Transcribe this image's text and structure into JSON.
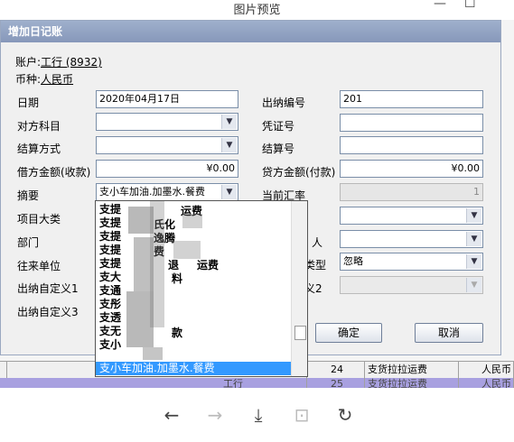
{
  "viewer": {
    "title": "图片预览",
    "minimize": "—",
    "maximize": "☐",
    "toolbar": {
      "prev": "←",
      "next": "→",
      "download": "⤓",
      "fit": "⊡",
      "rotate": "↻"
    }
  },
  "dialog": {
    "title": "增加日记账",
    "account_label": "账户:",
    "account_value": "工行 (8932)",
    "currency_label": "币种:",
    "currency_value": "人民币",
    "fields": {
      "date_label": "日期",
      "date_value": "2020年04月17日",
      "cashier_no_label": "出纳编号",
      "cashier_no_value": "201",
      "counter_subject_label": "对方科目",
      "voucher_no_label": "凭证号",
      "settle_method_label": "结算方式",
      "settle_no_label": "结算号",
      "debit_label": "借方金额(收款)",
      "debit_value": "¥0.00",
      "credit_label": "贷方金额(付款)",
      "credit_value": "¥0.00",
      "summary_label": "摘要",
      "summary_value": "支小车加油.加墨水.餐费",
      "exchange_rate_label": "当前汇率",
      "exchange_rate_value": "1",
      "project_category_label": "项目大类",
      "department_label": "部门",
      "partner_label": "往来单位",
      "custom1_label": "出纳自定义1",
      "custom3_label": "出纳自定义3",
      "person_label_partial": "人",
      "type_label_partial": "类型",
      "type_value": "忽略",
      "custom2_label_partial": "义2"
    },
    "ok_button": "确定",
    "cancel_button": "取消"
  },
  "dropdown": {
    "items": [
      "支提",
      "支提",
      "支提",
      "支提",
      "支提",
      "支大",
      "支通",
      "支彤",
      "支透",
      "支无",
      "支小",
      "支小车加油.加墨水.餐费"
    ],
    "fragments": [
      "运费",
      "氏化",
      "逸腾",
      "费",
      "退",
      "运费",
      "料",
      "款"
    ]
  },
  "table": {
    "rows": [
      {
        "num": "24",
        "summary": "支货拉拉运费",
        "currency": "人民币"
      },
      {
        "account": "工行",
        "num": "25",
        "summary": "支货拉拉运费",
        "currency": "人民币"
      }
    ]
  }
}
